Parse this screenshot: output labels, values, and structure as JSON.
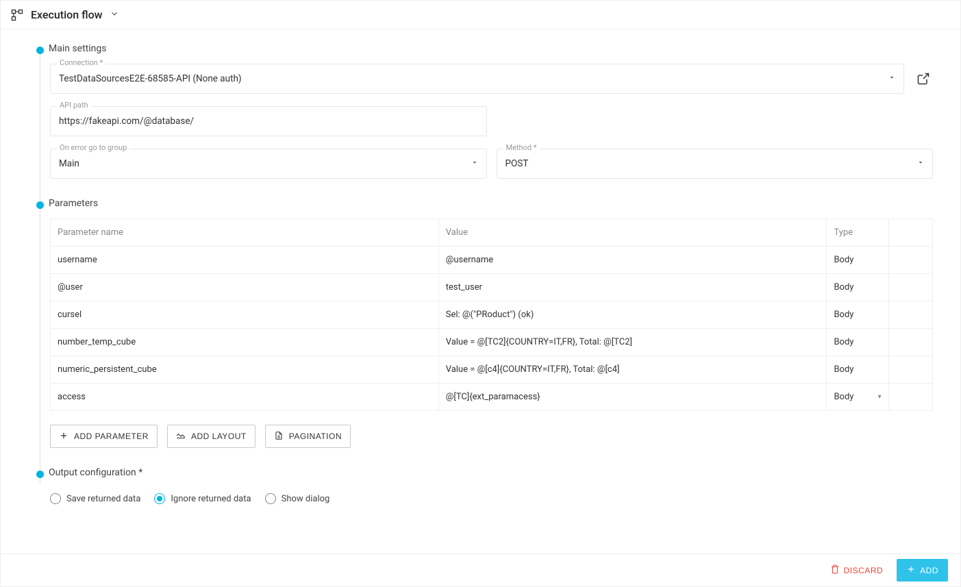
{
  "header": {
    "title": "Execution flow"
  },
  "sections": {
    "main_settings": {
      "title": "Main settings",
      "connection_label": "Connection *",
      "connection_value": "TestDataSourcesE2E-68585-API (None auth)",
      "api_path_label": "API path",
      "api_path_value": "https://fakeapi.com/@database/",
      "on_error_label": "On error go to group",
      "on_error_value": "Main",
      "method_label": "Method *",
      "method_value": "POST"
    },
    "parameters": {
      "title": "Parameters",
      "columns": {
        "name": "Parameter name",
        "value": "Value",
        "type": "Type"
      },
      "rows": [
        {
          "name": "username",
          "value": "@username",
          "type": "Body"
        },
        {
          "name": "@user",
          "value": "test_user",
          "type": "Body"
        },
        {
          "name": "cursel",
          "value": "Sel: @(\"PRoduct\") (ok)",
          "type": "Body"
        },
        {
          "name": "number_temp_cube",
          "value": "Value = @[TC2]{COUNTRY=IT,FR}, Total: @[TC2]",
          "type": "Body"
        },
        {
          "name": "numeric_persistent_cube",
          "value": "Value = @[c4]{COUNTRY=IT,FR}, Total: @[c4]",
          "type": "Body"
        },
        {
          "name": "access",
          "value": "@[TC]{ext_paramacess}",
          "type": "Body",
          "editable_type": true
        }
      ],
      "actions": {
        "add_parameter": "ADD PARAMETER",
        "add_layout": "ADD LAYOUT",
        "pagination": "PAGINATION"
      }
    },
    "output": {
      "title": "Output configuration *",
      "options": {
        "save": "Save returned data",
        "ignore": "Ignore returned data",
        "dialog": "Show dialog"
      },
      "selected": "ignore"
    }
  },
  "footer": {
    "discard": "DISCARD",
    "add": "ADD"
  }
}
